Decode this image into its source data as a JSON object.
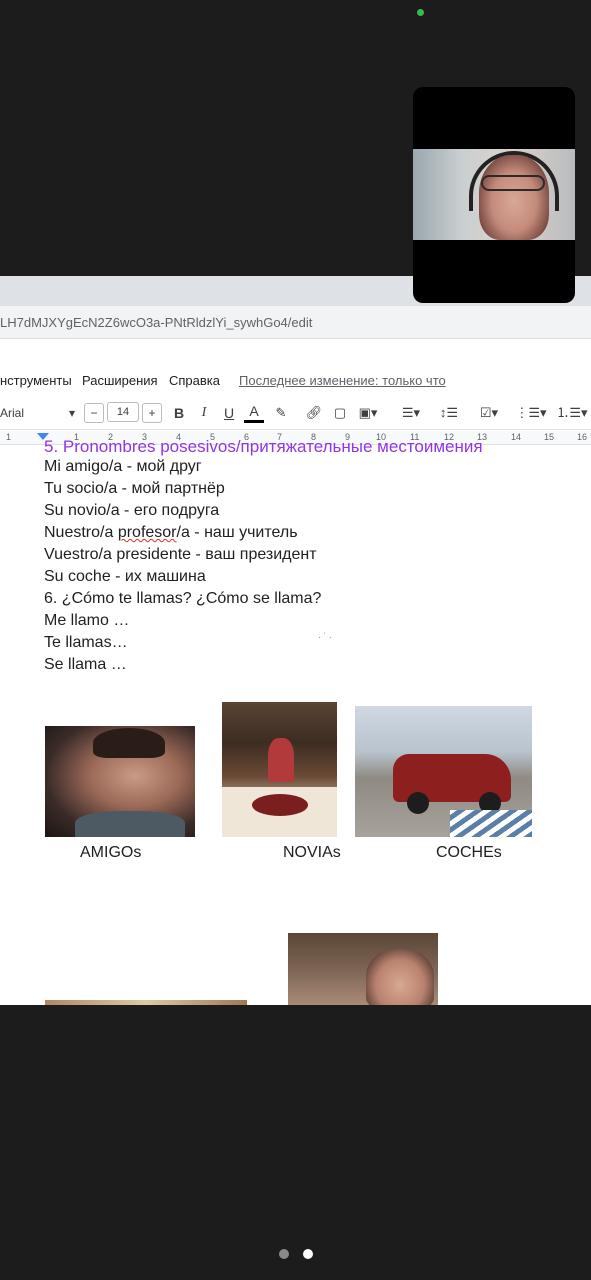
{
  "browser": {
    "url": "LH7dMJXYgEcN2Z6wcO3a-PNtRldzlYi_sywhGo4/edit"
  },
  "menubar": {
    "items": [
      "нструменты",
      "Расширения",
      "Справка"
    ],
    "last_edit": "Последнее изменение: только что"
  },
  "toolbar": {
    "font": "Arial",
    "minus": "−",
    "font_size": "14",
    "plus": "+",
    "bold": "B",
    "italic": "I",
    "underline": "U",
    "text_color": "A"
  },
  "ruler": {
    "ticks": [
      "1",
      "1",
      "2",
      "3",
      "4",
      "5",
      "6",
      "7",
      "8",
      "9",
      "10",
      "11",
      "12",
      "13",
      "14",
      "15",
      "16"
    ]
  },
  "document": {
    "heading": "5. Pronombres posesivos/притяжательные местоимения",
    "lines": [
      "Mi amigo/a - мой друг",
      "Tu socio/a - мой партнёр",
      "Su novio/a - его подруга",
      "Nuestro/a profesor/a - наш учитель",
      "Vuestro/a presidente - ваш президент",
      "Su coche -  их машина",
      "6. ¿Cómo te llamas? ¿Cómo se llama?",
      "Me llamo …",
      "Te llamas…",
      "Se llama …"
    ],
    "line4_prefix": "Nuestro/a ",
    "line4_squiggle": "profesor",
    "line4_suffix": "/a - наш учитель",
    "captions": {
      "amigos": "AMIGOs",
      "novias": "NOVIAs",
      "coches": "COCHEs"
    }
  },
  "colors": {
    "heading": "#9334e6",
    "accent": "#4285f4",
    "camera_dot": "#2fbf4f"
  },
  "pager": {
    "count": 2,
    "active": 2
  }
}
